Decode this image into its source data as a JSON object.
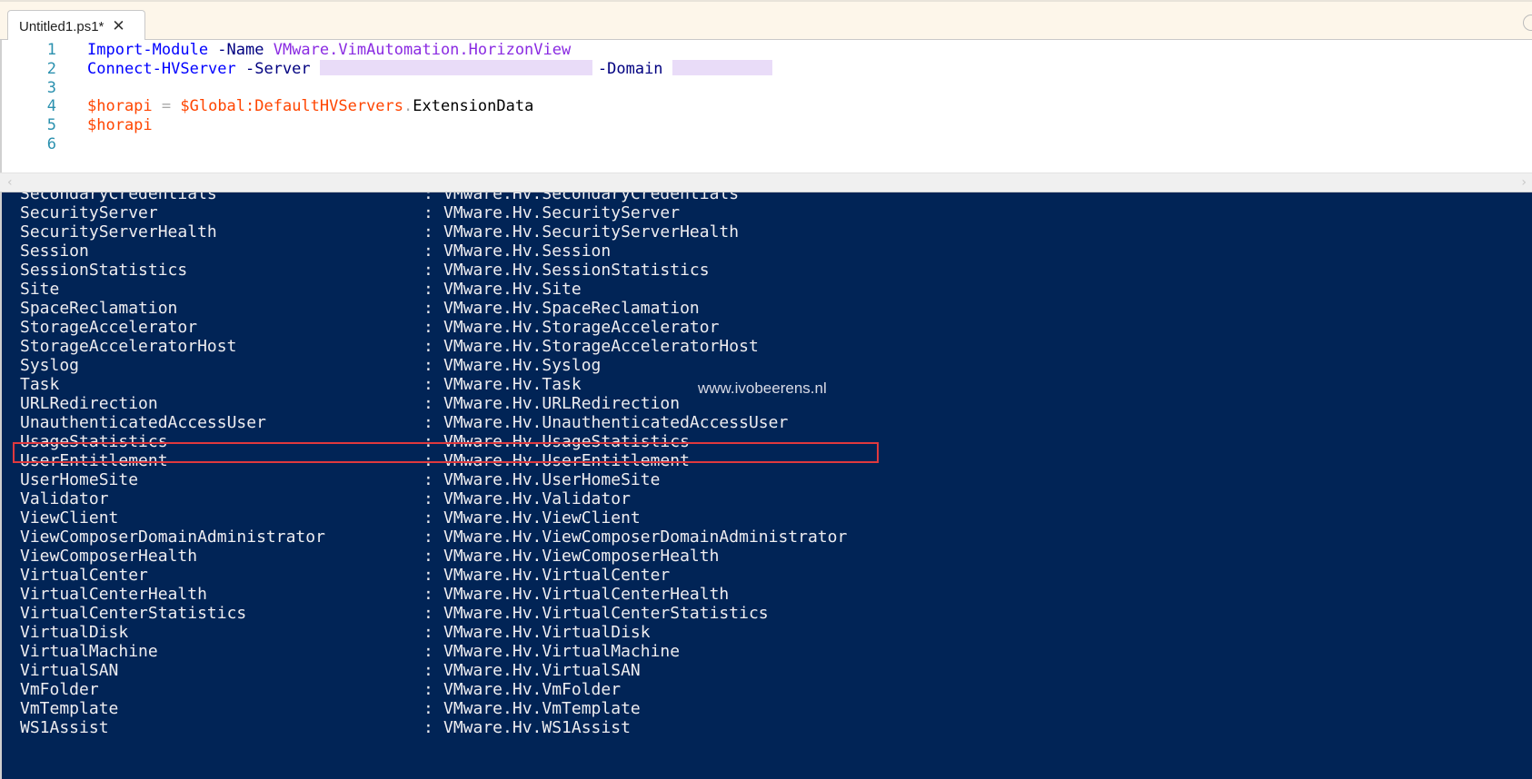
{
  "tab": {
    "title": "Untitled1.ps1*",
    "close_glyph": "✕"
  },
  "editor": {
    "lines": [
      {
        "n": "1",
        "parts": [
          {
            "t": "Import-Module",
            "c": "kw"
          },
          {
            "t": " -Name ",
            "c": "param"
          },
          {
            "t": "VMware.VimAutomation.HorizonView",
            "c": "str"
          }
        ]
      },
      {
        "n": "2",
        "parts": [
          {
            "t": "Connect-HVServer",
            "c": "kw"
          },
          {
            "t": " -Server ",
            "c": "param"
          },
          {
            "t": "",
            "c": "redact-server"
          },
          {
            "t": "-Domain ",
            "c": "param"
          },
          {
            "t": "",
            "c": "redact-domain"
          }
        ]
      },
      {
        "n": "3",
        "parts": []
      },
      {
        "n": "4",
        "parts": [
          {
            "t": "$horapi",
            "c": "var"
          },
          {
            "t": " = ",
            "c": "op"
          },
          {
            "t": "$Global:DefaultHVServers",
            "c": "var"
          },
          {
            "t": ".",
            "c": "op"
          },
          {
            "t": "ExtensionData",
            "c": "plain"
          }
        ]
      },
      {
        "n": "5",
        "parts": [
          {
            "t": "$horapi",
            "c": "var"
          }
        ]
      },
      {
        "n": "6",
        "parts": []
      }
    ]
  },
  "scroll": {
    "left_arrow": "‹",
    "right_arrow": "›"
  },
  "console": {
    "separator": ":",
    "rows": [
      {
        "k": "SecondaryCredentials",
        "v": "VMware.Hv.SecondaryCredentials"
      },
      {
        "k": "SecurityServer",
        "v": "VMware.Hv.SecurityServer"
      },
      {
        "k": "SecurityServerHealth",
        "v": "VMware.Hv.SecurityServerHealth"
      },
      {
        "k": "Session",
        "v": "VMware.Hv.Session"
      },
      {
        "k": "SessionStatistics",
        "v": "VMware.Hv.SessionStatistics"
      },
      {
        "k": "Site",
        "v": "VMware.Hv.Site"
      },
      {
        "k": "SpaceReclamation",
        "v": "VMware.Hv.SpaceReclamation"
      },
      {
        "k": "StorageAccelerator",
        "v": "VMware.Hv.StorageAccelerator"
      },
      {
        "k": "StorageAcceleratorHost",
        "v": "VMware.Hv.StorageAcceleratorHost"
      },
      {
        "k": "Syslog",
        "v": "VMware.Hv.Syslog"
      },
      {
        "k": "Task",
        "v": "VMware.Hv.Task"
      },
      {
        "k": "URLRedirection",
        "v": "VMware.Hv.URLRedirection"
      },
      {
        "k": "UnauthenticatedAccessUser",
        "v": "VMware.Hv.UnauthenticatedAccessUser"
      },
      {
        "k": "UsageStatistics",
        "v": "VMware.Hv.UsageStatistics"
      },
      {
        "k": "UserEntitlement",
        "v": "VMware.Hv.UserEntitlement"
      },
      {
        "k": "UserHomeSite",
        "v": "VMware.Hv.UserHomeSite"
      },
      {
        "k": "Validator",
        "v": "VMware.Hv.Validator"
      },
      {
        "k": "ViewClient",
        "v": "VMware.Hv.ViewClient"
      },
      {
        "k": "ViewComposerDomainAdministrator",
        "v": "VMware.Hv.ViewComposerDomainAdministrator"
      },
      {
        "k": "ViewComposerHealth",
        "v": "VMware.Hv.ViewComposerHealth"
      },
      {
        "k": "VirtualCenter",
        "v": "VMware.Hv.VirtualCenter"
      },
      {
        "k": "VirtualCenterHealth",
        "v": "VMware.Hv.VirtualCenterHealth"
      },
      {
        "k": "VirtualCenterStatistics",
        "v": "VMware.Hv.VirtualCenterStatistics"
      },
      {
        "k": "VirtualDisk",
        "v": "VMware.Hv.VirtualDisk"
      },
      {
        "k": "VirtualMachine",
        "v": "VMware.Hv.VirtualMachine"
      },
      {
        "k": "VirtualSAN",
        "v": "VMware.Hv.VirtualSAN"
      },
      {
        "k": "VmFolder",
        "v": "VMware.Hv.VmFolder"
      },
      {
        "k": "VmTemplate",
        "v": "VMware.Hv.VmTemplate"
      },
      {
        "k": "WS1Assist",
        "v": "VMware.Hv.WS1Assist"
      }
    ],
    "highlighted_key": "UsageStatistics",
    "watermark": "www.ivobeerens.nl"
  },
  "colors": {
    "console_bg": "#012456",
    "console_text": "#eeedf0",
    "highlight_border": "#e0393e"
  }
}
